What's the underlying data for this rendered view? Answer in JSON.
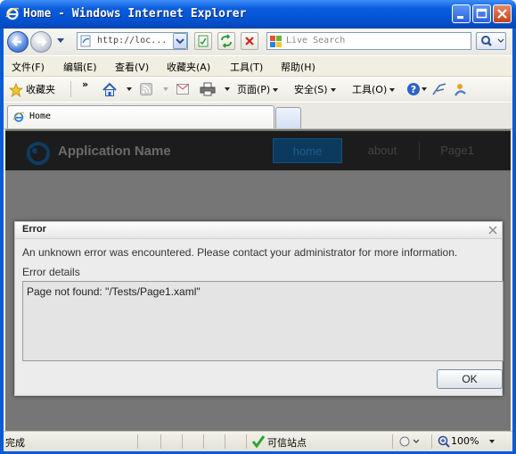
{
  "window": {
    "title": "Home - Windows Internet Explorer"
  },
  "address_bar": {
    "url": "http://loc..."
  },
  "search": {
    "placeholder": "Live Search"
  },
  "menu": {
    "items": [
      "文件(F)",
      "编辑(E)",
      "查看(V)",
      "收藏夹(A)",
      "工具(T)",
      "帮助(H)"
    ]
  },
  "toolbar": {
    "favorites": "收藏夹",
    "page": "页面(P)",
    "safety": "安全(S)",
    "tools": "工具(O)"
  },
  "tabs": [
    {
      "title": "Home",
      "active": true
    }
  ],
  "app": {
    "name": "Application Name",
    "nav": [
      "home",
      "about",
      "Page1"
    ],
    "active_nav": "home",
    "colors": {
      "header": "#1c1c1c",
      "body": "#767676",
      "active_nav": "#0c3a5e"
    }
  },
  "dialog": {
    "title": "Error",
    "message": "An unknown error was encountered. Please contact your administrator for more information.",
    "details_label": "Error details",
    "details": "Page not found: \"/Tests/Page1.xaml\"",
    "ok_label": "OK"
  },
  "status": {
    "text": "完成",
    "zone": "可信站点",
    "zoom": "100%"
  },
  "colors": {
    "titlebar": "#0352d0",
    "ok_icon": "#2ea52e"
  }
}
